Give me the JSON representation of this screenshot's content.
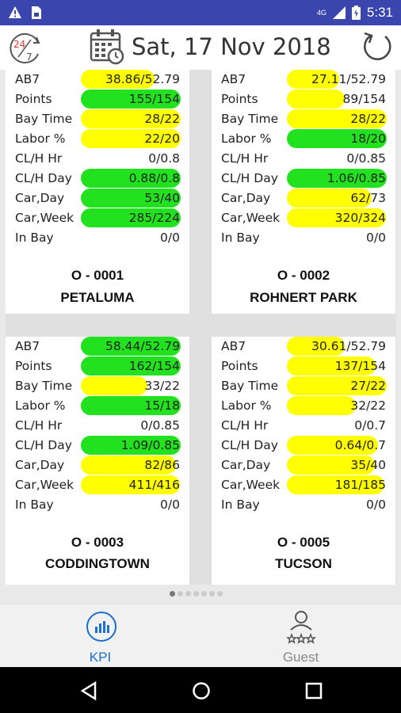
{
  "status": {
    "time": "5:31",
    "network": "4G"
  },
  "header": {
    "date": "Sat, 17 Nov 2018"
  },
  "labels": [
    "AB7",
    "Points",
    "Bay Time",
    "Labor %",
    "CL/H Hr",
    "CL/H Day",
    "Car,Day",
    "Car,Week",
    "In Bay"
  ],
  "colors": {
    "green": "#22e11f",
    "yellow": "#ffff00",
    "status": "#3a46ad",
    "active_tab": "#1a6fd1"
  },
  "stores": [
    {
      "code": "O - 0001",
      "name": "PETALUMA",
      "values": [
        "38.86/52.79",
        "155/154",
        "28/22",
        "22/20",
        "0/0.8",
        "0.88/0.8",
        "53/40",
        "285/224",
        "0/0"
      ],
      "fills": [
        {
          "c": "yellow",
          "f": 0.74
        },
        {
          "c": "green",
          "f": 1
        },
        {
          "c": "yellow",
          "f": 1
        },
        {
          "c": "yellow",
          "f": 1
        },
        null,
        {
          "c": "green",
          "f": 1
        },
        {
          "c": "green",
          "f": 1
        },
        {
          "c": "green",
          "f": 1
        },
        null
      ]
    },
    {
      "code": "O - 0002",
      "name": "ROHNERT PARK",
      "values": [
        "27.11/52.79",
        "89/154",
        "28/22",
        "18/20",
        "0/0.85",
        "1.06/0.85",
        "62/73",
        "320/324",
        "0/0"
      ],
      "fills": [
        {
          "c": "yellow",
          "f": 0.52
        },
        {
          "c": "yellow",
          "f": 0.58
        },
        {
          "c": "yellow",
          "f": 1
        },
        {
          "c": "green",
          "f": 1
        },
        null,
        {
          "c": "green",
          "f": 1
        },
        {
          "c": "yellow",
          "f": 0.85
        },
        {
          "c": "yellow",
          "f": 0.99
        },
        null
      ]
    },
    {
      "code": "O - 0003",
      "name": "CODDINGTOWN",
      "values": [
        "58.44/52.79",
        "162/154",
        "33/22",
        "15/18",
        "0/0.85",
        "1.09/0.85",
        "82/86",
        "411/416",
        "0/0"
      ],
      "fills": [
        {
          "c": "green",
          "f": 1
        },
        {
          "c": "green",
          "f": 1
        },
        {
          "c": "yellow",
          "f": 0.67
        },
        {
          "c": "green",
          "f": 1
        },
        null,
        {
          "c": "green",
          "f": 1
        },
        {
          "c": "yellow",
          "f": 0.95
        },
        {
          "c": "yellow",
          "f": 0.99
        },
        null
      ]
    },
    {
      "code": "O - 0005",
      "name": "TUCSON",
      "values": [
        "30.61/52.79",
        "137/154",
        "27/22",
        "32/22",
        "0/0.7",
        "0.64/0.7",
        "35/40",
        "181/185",
        "0/0"
      ],
      "fills": [
        {
          "c": "yellow",
          "f": 0.58
        },
        {
          "c": "yellow",
          "f": 0.89
        },
        {
          "c": "yellow",
          "f": 1
        },
        {
          "c": "yellow",
          "f": 0.69
        },
        null,
        {
          "c": "yellow",
          "f": 0.91
        },
        {
          "c": "yellow",
          "f": 0.88
        },
        {
          "c": "yellow",
          "f": 0.98
        },
        null
      ]
    }
  ],
  "pager": {
    "count": 7,
    "active": 0
  },
  "tabs": [
    {
      "label": "KPI",
      "icon": "chart-icon"
    },
    {
      "label": "Guest",
      "icon": "guest-rating-icon"
    }
  ]
}
